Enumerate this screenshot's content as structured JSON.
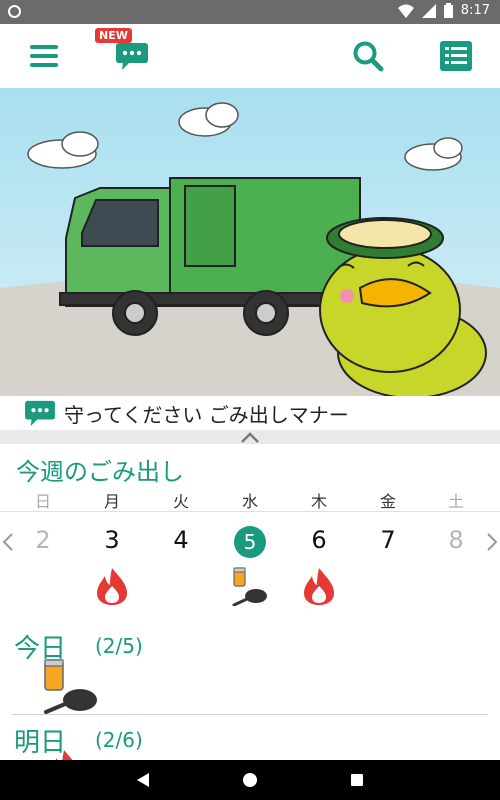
{
  "status_bar": {
    "time": "8:17"
  },
  "app_bar": {
    "new_badge": "NEW"
  },
  "notice": {
    "text": "守ってください ごみ出しマナー"
  },
  "week": {
    "title": "今週のごみ出し",
    "weekdays": [
      "日",
      "月",
      "火",
      "水",
      "木",
      "金",
      "土"
    ],
    "dates": [
      "2",
      "3",
      "4",
      "5",
      "6",
      "7",
      "8"
    ],
    "today_index": 3,
    "garbage": [
      "",
      "burnable",
      "",
      "cans-pan",
      "burnable",
      "",
      ""
    ]
  },
  "cards": [
    {
      "label": "今日",
      "date": "(2/5)",
      "garbage": "cans-pan"
    },
    {
      "label": "明日",
      "date": "(2/6)",
      "garbage": "burnable"
    }
  ],
  "colors": {
    "accent": "#1a9a7f",
    "fire": "#e53935"
  }
}
